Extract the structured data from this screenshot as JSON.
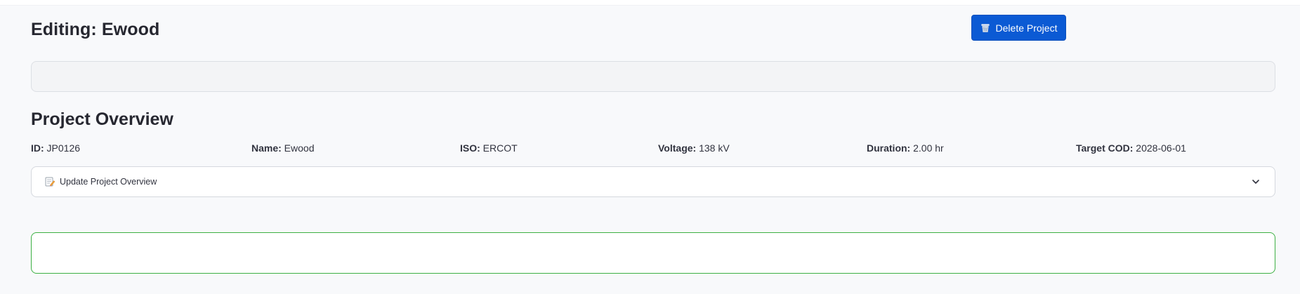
{
  "header": {
    "title": "Editing: Ewood",
    "delete_label": "Delete Project",
    "delete_icon": "trash-basket-icon"
  },
  "overview": {
    "title": "Project Overview",
    "fields": [
      {
        "label": "ID:",
        "value": " JP0126"
      },
      {
        "label": "Name:",
        "value": " Ewood"
      },
      {
        "label": "ISO:",
        "value": " ERCOT"
      },
      {
        "label": "Voltage:",
        "value": " 138 kV"
      },
      {
        "label": "Duration:",
        "value": " 2.00 hr"
      },
      {
        "label": "Target COD:",
        "value": " 2028-06-01"
      }
    ],
    "expander_label": "Update Project Overview",
    "expander_icon": "memo-pencil-icon",
    "expander_state_icon": "chevron-down-icon"
  },
  "colors": {
    "primary": "#0b5ad4",
    "success_border": "#3cb043",
    "background": "#f8f9fb"
  }
}
